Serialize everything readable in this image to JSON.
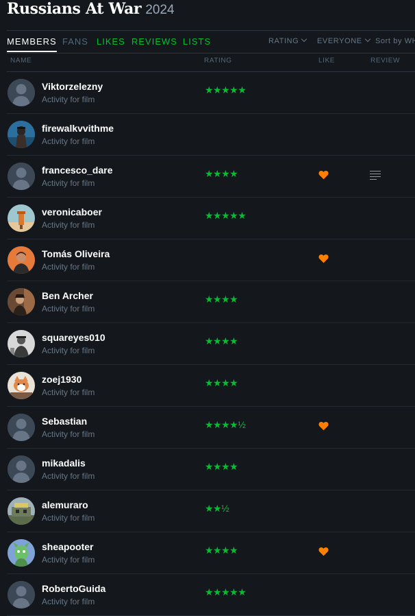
{
  "film": {
    "title": "Russians At War",
    "year": "2024"
  },
  "tabs": [
    {
      "label": "MEMBERS",
      "state": "active"
    },
    {
      "label": "FANS",
      "state": "dim"
    },
    {
      "label": "LIKES",
      "state": "green"
    },
    {
      "label": "REVIEWS",
      "state": "green"
    },
    {
      "label": "LISTS",
      "state": "green"
    }
  ],
  "filters": {
    "rating": "RATING",
    "everyone": "EVERYONE",
    "sort": "Sort by WH"
  },
  "columns": {
    "name": "NAME",
    "rating": "RATING",
    "like": "LIKE",
    "review": "REVIEW"
  },
  "colors": {
    "background": "#14181c",
    "green": "#00c030",
    "orange": "#ff8000",
    "muted": "#678"
  },
  "members": [
    {
      "name": "Viktorzelezny",
      "activity": "Activity for film",
      "rating": "★★★★★",
      "rating_value": 5,
      "liked": false,
      "reviewed": false,
      "avatar": "default"
    },
    {
      "name": "firewalkvvithme",
      "activity": "Activity for film",
      "rating": "",
      "rating_value": null,
      "liked": false,
      "reviewed": false,
      "avatar": "custom"
    },
    {
      "name": "francesco_dare",
      "activity": "Activity for film",
      "rating": "★★★★",
      "rating_value": 4,
      "liked": true,
      "reviewed": true,
      "avatar": "default"
    },
    {
      "name": "veronicaboer",
      "activity": "Activity for film",
      "rating": "★★★★★",
      "rating_value": 5,
      "liked": false,
      "reviewed": false,
      "avatar": "custom"
    },
    {
      "name": "Tomás Oliveira",
      "activity": "Activity for film",
      "rating": "",
      "rating_value": null,
      "liked": true,
      "reviewed": false,
      "avatar": "custom"
    },
    {
      "name": "Ben Archer",
      "activity": "Activity for film",
      "rating": "★★★★",
      "rating_value": 4,
      "liked": false,
      "reviewed": false,
      "avatar": "custom"
    },
    {
      "name": "squareyes010",
      "activity": "Activity for film",
      "rating": "★★★★",
      "rating_value": 4,
      "liked": false,
      "reviewed": false,
      "avatar": "custom"
    },
    {
      "name": "zoej1930",
      "activity": "Activity for film",
      "rating": "★★★★",
      "rating_value": 4,
      "liked": false,
      "reviewed": false,
      "avatar": "custom"
    },
    {
      "name": "Sebastian",
      "activity": "Activity for film",
      "rating": "★★★★½",
      "rating_value": 4.5,
      "liked": true,
      "reviewed": false,
      "avatar": "default"
    },
    {
      "name": "mikadalis",
      "activity": "Activity for film",
      "rating": "★★★★",
      "rating_value": 4,
      "liked": false,
      "reviewed": false,
      "avatar": "default"
    },
    {
      "name": "alemuraro",
      "activity": "Activity for film",
      "rating": "★★½",
      "rating_value": 2.5,
      "liked": false,
      "reviewed": false,
      "avatar": "custom"
    },
    {
      "name": "sheapooter",
      "activity": "Activity for film",
      "rating": "★★★★",
      "rating_value": 4,
      "liked": true,
      "reviewed": false,
      "avatar": "custom"
    },
    {
      "name": "RobertoGuida",
      "activity": "Activity for film",
      "rating": "★★★★★",
      "rating_value": 5,
      "liked": false,
      "reviewed": false,
      "avatar": "default"
    }
  ]
}
